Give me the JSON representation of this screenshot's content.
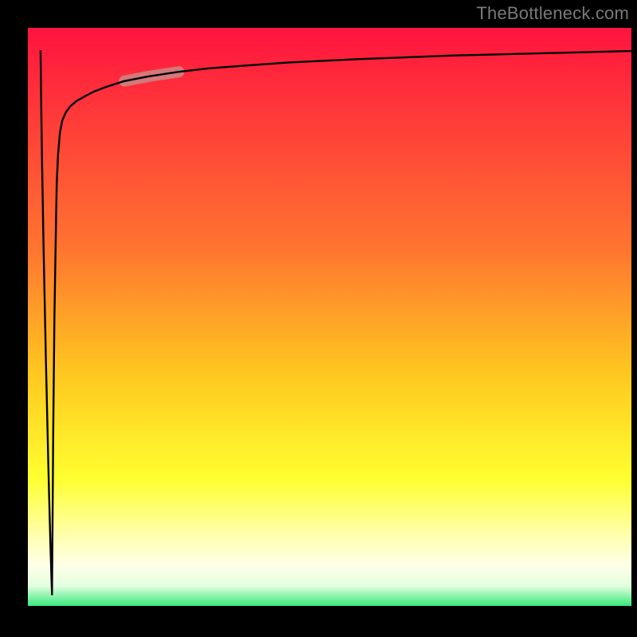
{
  "watermark": "TheBottleneck.com",
  "chart_data": {
    "type": "line",
    "title": "",
    "xlabel": "",
    "ylabel": "",
    "xlim": [
      0,
      100
    ],
    "ylim": [
      0,
      100
    ],
    "gradient_stops": [
      {
        "offset": 0.0,
        "color": "#ff133f"
      },
      {
        "offset": 0.38,
        "color": "#ff7430"
      },
      {
        "offset": 0.6,
        "color": "#ffc820"
      },
      {
        "offset": 0.78,
        "color": "#ffff30"
      },
      {
        "offset": 0.88,
        "color": "#ffffb0"
      },
      {
        "offset": 0.93,
        "color": "#ffffe8"
      },
      {
        "offset": 0.965,
        "color": "#e4ffe0"
      },
      {
        "offset": 1.0,
        "color": "#38e87c"
      }
    ],
    "series": [
      {
        "name": "black-curve",
        "x": [
          4.0,
          4.2,
          4.4,
          4.64,
          4.78,
          5.0,
          5.3,
          5.7,
          6.3,
          7.0,
          8.0,
          9.5,
          11.0,
          13.0,
          16.0,
          20.0,
          25.0,
          30.0,
          35.0,
          43.0,
          55.0,
          70.0,
          85.0,
          100.0
        ],
        "y": [
          2.0,
          30.0,
          50.0,
          65.0,
          73.0,
          78.0,
          81.8,
          84.0,
          85.4,
          86.4,
          87.3,
          88.2,
          89.0,
          89.8,
          90.8,
          91.6,
          92.4,
          93.0,
          93.4,
          94.0,
          94.6,
          95.2,
          95.6,
          96.0
        ]
      },
      {
        "name": "black-descend",
        "x": [
          2.1,
          2.3,
          2.6,
          3.0,
          3.4,
          3.7,
          3.9,
          4.0
        ],
        "y": [
          96.0,
          80.0,
          62.0,
          42.0,
          24.0,
          12.0,
          5.0,
          2.0
        ]
      }
    ],
    "highlight_segment": {
      "name": "highlight-band",
      "x_range": [
        16.0,
        25.0
      ],
      "y_range": [
        90.8,
        92.4
      ],
      "color": "#c98b87",
      "opacity": 0.82,
      "stroke_width_px": 14
    }
  }
}
